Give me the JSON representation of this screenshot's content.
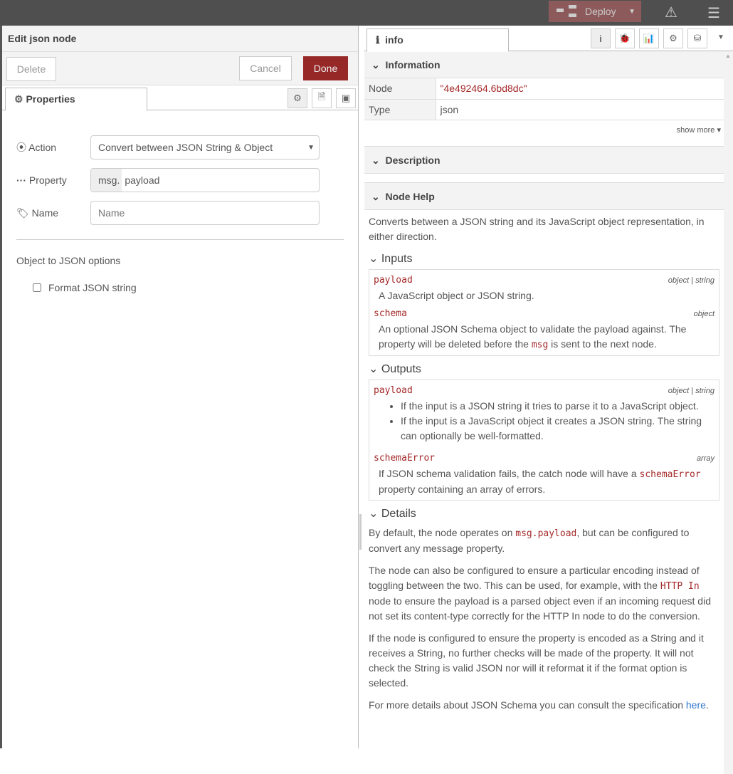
{
  "topbar": {
    "deploy_label": "Deploy"
  },
  "editor": {
    "title": "Edit json node",
    "delete": "Delete",
    "cancel": "Cancel",
    "done": "Done",
    "tab": "Properties",
    "action_label": "Action",
    "action_value": "Convert between JSON String & Object",
    "property_label": "Property",
    "property_prefix": "msg.",
    "property_value": "payload",
    "name_label": "Name",
    "name_placeholder": "Name",
    "options_heading": "Object to JSON options",
    "format_label": "Format JSON string",
    "format_checked": false
  },
  "sidebar": {
    "tab": "info",
    "information": "Information",
    "node_label": "Node",
    "node_value": "\"4e492464.6bd8dc\"",
    "type_label": "Type",
    "type_value": "json",
    "show_more": "show more",
    "description": "Description",
    "node_help": "Node Help",
    "intro": "Converts between a JSON string and its JavaScript object representation, in either direction.",
    "inputs": "Inputs",
    "in_payload": "payload",
    "in_payload_type": "object | string",
    "in_payload_desc": "A JavaScript object or JSON string.",
    "in_schema": "schema",
    "in_schema_type": "object",
    "in_schema_desc1": "An optional JSON Schema object to validate the payload against. The property will be deleted before the ",
    "in_schema_code": "msg",
    "in_schema_desc2": " is sent to the next node.",
    "outputs": "Outputs",
    "out_payload": "payload",
    "out_payload_type": "object | string",
    "out_b1": "If the input is a JSON string it tries to parse it to a JavaScript object.",
    "out_b2": "If the input is a JavaScript object it creates a JSON string. The string can optionally be well-formatted.",
    "out_err": "schemaError",
    "out_err_type": "array",
    "out_err_desc1": "If JSON schema validation fails, the catch node will have a ",
    "out_err_code": "schemaError",
    "out_err_desc2": " property containing an array of errors.",
    "details": "Details",
    "d1a": "By default, the node operates on ",
    "d1code": "msg.payload",
    "d1b": ", but can be configured to convert any message property.",
    "d2a": "The node can also be configured to ensure a particular encoding instead of toggling between the two. This can be used, for example, with the ",
    "d2code": "HTTP In",
    "d2b": " node to ensure the payload is a parsed object even if an incoming request did not set its content-type correctly for the HTTP In node to do the conversion.",
    "d3": "If the node is configured to ensure the property is encoded as a String and it receives a String, no further checks will be made of the property. It will not check the String is valid JSON nor will it reformat it if the format option is selected.",
    "d4a": "For more details about JSON Schema you can consult the specification ",
    "d4link": "here",
    "d4b": "."
  }
}
